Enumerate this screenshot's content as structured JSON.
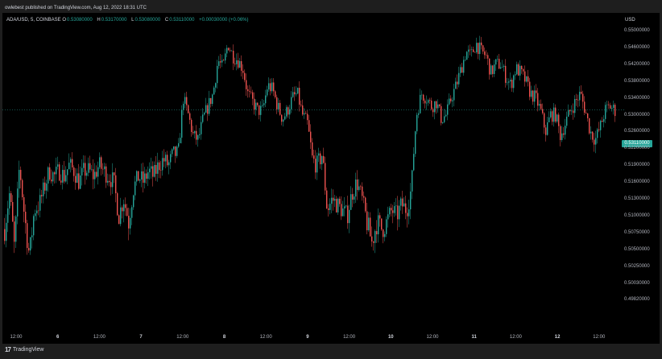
{
  "header": {
    "published": "owlebest published on TradingView.com, Aug 12, 2022 18:31 UTC"
  },
  "symbol": {
    "name": "ADA/USD, 5, COINBASE",
    "o_key": "O",
    "o_val": "0.53080000",
    "h_key": "H",
    "h_val": "0.53170000",
    "l_key": "L",
    "l_val": "0.53080000",
    "c_key": "C",
    "c_val": "0.53110000",
    "change": "+0.00030000 (+0.06%)"
  },
  "currency": "USD",
  "current_price": "0.53110000",
  "footer": {
    "brand": "TradingView",
    "logo": "17"
  },
  "colors": {
    "up": "#26a69a",
    "down": "#ef5350",
    "background": "#000000",
    "current": "#26a69a"
  },
  "chart_data": {
    "type": "candlestick",
    "y_tick_labels": [
      "0.55000000",
      "0.54600000",
      "0.54200000",
      "0.53800000",
      "0.53400000",
      "0.53000000",
      "0.52600000",
      "0.52200000",
      "0.51900000",
      "0.51600000",
      "0.51300000",
      "0.51000000",
      "0.50750000",
      "0.50500000",
      "0.50250000",
      "0.50030000",
      "0.49820000"
    ],
    "x_tick_labels": [
      {
        "label": "12:00",
        "major": false
      },
      {
        "label": "6",
        "major": true
      },
      {
        "label": "12:00",
        "major": false
      },
      {
        "label": "7",
        "major": true
      },
      {
        "label": "12:00",
        "major": false
      },
      {
        "label": "8",
        "major": true
      },
      {
        "label": "12:00",
        "major": false
      },
      {
        "label": "9",
        "major": true
      },
      {
        "label": "12:00",
        "major": false
      },
      {
        "label": "10",
        "major": true
      },
      {
        "label": "12:00",
        "major": false
      },
      {
        "label": "11",
        "major": true
      },
      {
        "label": "12:00",
        "major": false
      },
      {
        "label": "12",
        "major": true
      },
      {
        "label": "12:00",
        "major": false
      }
    ],
    "price_path": [
      0.508,
      0.514,
      0.505,
      0.519,
      0.51,
      0.504,
      0.511,
      0.512,
      0.515,
      0.518,
      0.517,
      0.518,
      0.517,
      0.519,
      0.518,
      0.516,
      0.518,
      0.518,
      0.517,
      0.519,
      0.518,
      0.517,
      0.516,
      0.51,
      0.513,
      0.509,
      0.515,
      0.517,
      0.516,
      0.518,
      0.517,
      0.519,
      0.52,
      0.519,
      0.521,
      0.521,
      0.534,
      0.53,
      0.525,
      0.524,
      0.529,
      0.532,
      0.535,
      0.543,
      0.541,
      0.547,
      0.544,
      0.543,
      0.541,
      0.535,
      0.533,
      0.531,
      0.531,
      0.537,
      0.536,
      0.532,
      0.529,
      0.531,
      0.534,
      0.535,
      0.53,
      0.528,
      0.52,
      0.519,
      0.521,
      0.511,
      0.513,
      0.512,
      0.511,
      0.51,
      0.514,
      0.516,
      0.513,
      0.509,
      0.506,
      0.509,
      0.508,
      0.509,
      0.511,
      0.51,
      0.512,
      0.511,
      0.515,
      0.53,
      0.535,
      0.534,
      0.532,
      0.533,
      0.529,
      0.53,
      0.534,
      0.537,
      0.541,
      0.545,
      0.544,
      0.547,
      0.545,
      0.544,
      0.54,
      0.542,
      0.542,
      0.539,
      0.537,
      0.541,
      0.54,
      0.538,
      0.535,
      0.534,
      0.531,
      0.526,
      0.53,
      0.53,
      0.525,
      0.528,
      0.531,
      0.533,
      0.535,
      0.531,
      0.526,
      0.524,
      0.527,
      0.531,
      0.532,
      0.531
    ],
    "current_price": 0.5311,
    "grid": false,
    "legend": "top-left"
  }
}
